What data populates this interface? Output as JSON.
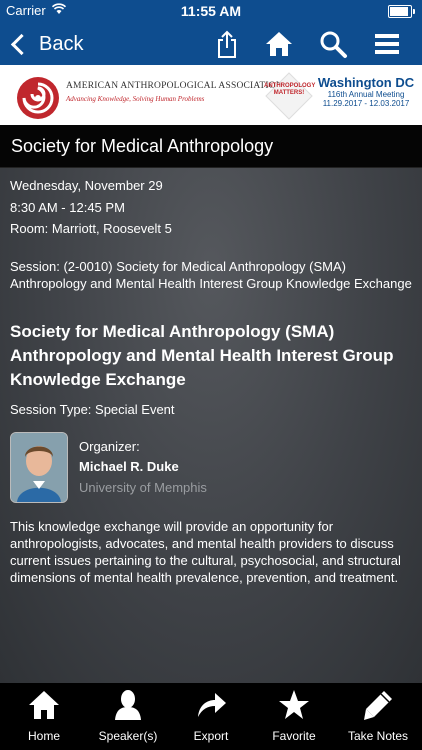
{
  "status_bar": {
    "carrier": "Carrier",
    "time": "11:55 AM"
  },
  "nav": {
    "back_label": "Back"
  },
  "banner": {
    "org_name": "AMERICAN ANTHROPOLOGICAL ASSOCIATION",
    "tagline": "Advancing Knowledge, Solving Human Problems",
    "badge_text": "ANTHROPOLOGY MATTERS!",
    "city": "Washington DC",
    "meeting": "116th Annual Meeting",
    "dates": "11.29.2017 - 12.03.2017"
  },
  "section": {
    "title": "Society for Medical Anthropology"
  },
  "event": {
    "date": "Wednesday, November 29",
    "time": "8:30 AM - 12:45 PM",
    "room": "Room: Marriott, Roosevelt 5",
    "session_code": "Session: (2-0010) Society for Medical Anthropology (SMA) Anthropology and Mental Health Interest Group Knowledge Exchange",
    "session_title": "Society for Medical Anthropology (SMA) Anthropology and Mental Health Interest Group Knowledge Exchange",
    "session_type": "Session Type: Special Event",
    "organizer_label": "Organizer:",
    "organizer_name": "Michael R. Duke",
    "organizer_org": "University of Memphis",
    "description": "This knowledge exchange will provide an opportunity for anthropologists, advocates, and mental health providers to discuss current issues pertaining to the cultural, psychosocial, and structural dimensions of mental health prevalence, prevention, and treatment."
  },
  "tabs": [
    {
      "label": "Home",
      "icon": "home-icon"
    },
    {
      "label": "Speaker(s)",
      "icon": "person-icon"
    },
    {
      "label": "Export",
      "icon": "export-arrow-icon"
    },
    {
      "label": "Favorite",
      "icon": "star-icon"
    },
    {
      "label": "Take Notes",
      "icon": "pencil-icon"
    }
  ],
  "colors": {
    "nav_blue": "#0e4d8f",
    "brand_red": "#c0272d",
    "tab_bar": "#000000"
  }
}
